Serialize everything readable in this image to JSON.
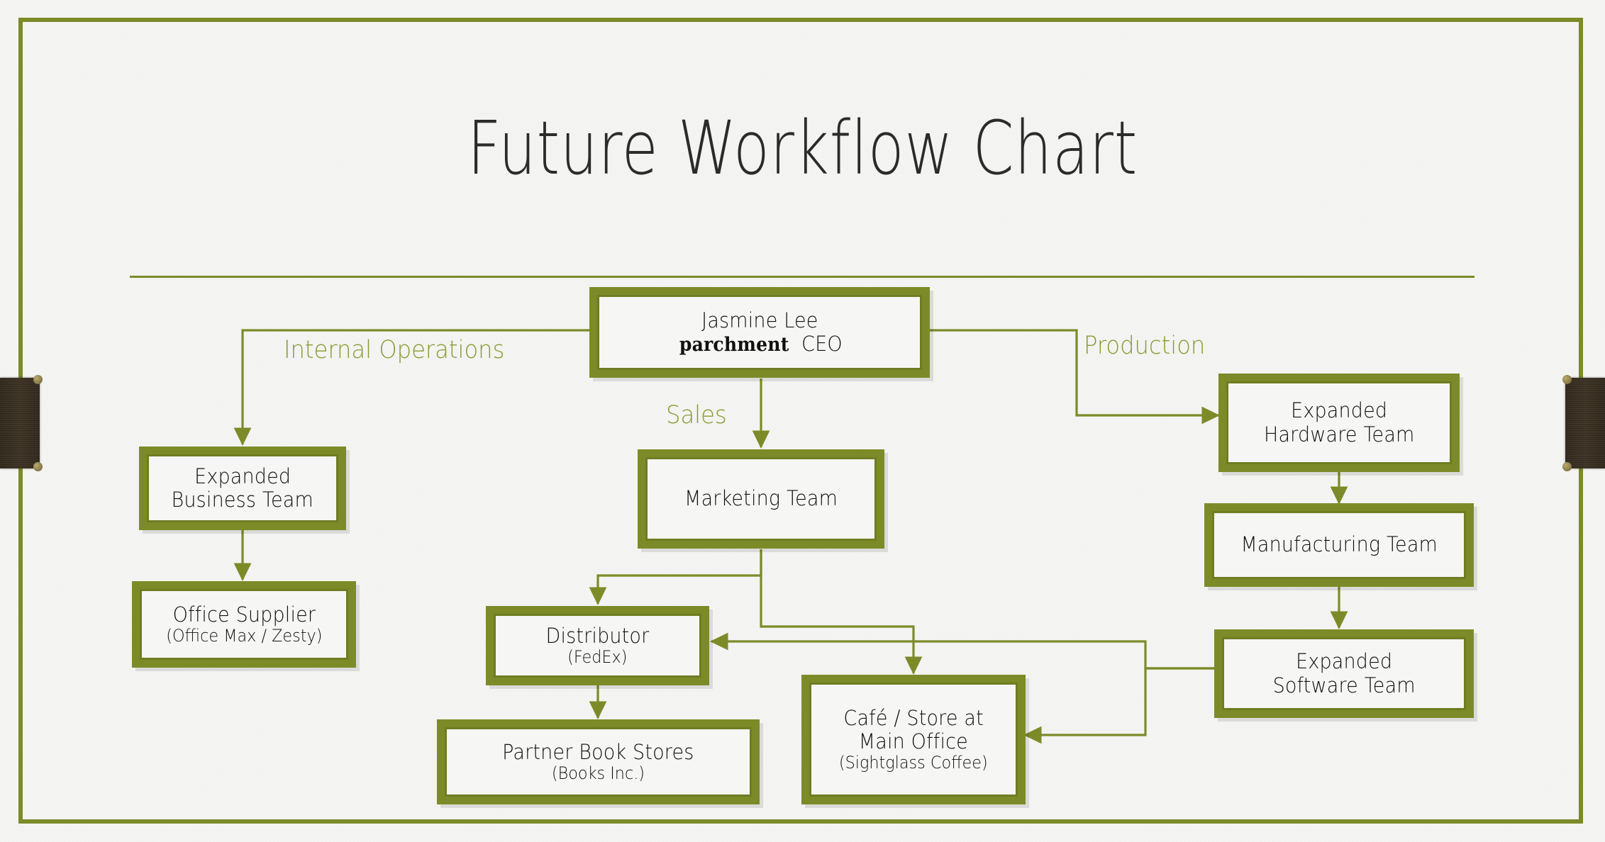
{
  "slide": {
    "title": "Future Workflow Chart",
    "accent_color": "#7c8b28",
    "label_color": "#8a9a33",
    "frame_color": "#7c8b28",
    "tab_color": "#3d3325",
    "background_color": "#f4f4f2"
  },
  "branch_labels": {
    "internal_operations": "Internal Operations",
    "sales": "Sales",
    "production": "Production"
  },
  "nodes": {
    "ceo": {
      "line1": "Jasmine Lee",
      "line2_brand": "parchment",
      "line2_role": "CEO"
    },
    "business_team": {
      "line1": "Expanded",
      "line2": "Business Team"
    },
    "office_supplier": {
      "line1": "Office Supplier",
      "line2": "(Office Max / Zesty)"
    },
    "marketing_team": {
      "line1": "Marketing Team"
    },
    "distributor": {
      "line1": "Distributor",
      "line2": "(FedEx)"
    },
    "partner_stores": {
      "line1": "Partner Book Stores",
      "line2": "(Books Inc.)"
    },
    "cafe_store": {
      "line1": "Café / Store at",
      "line2": "Main Office",
      "line3": "(Sightglass Coffee)"
    },
    "hardware_team": {
      "line1": "Expanded",
      "line2": "Hardware Team"
    },
    "manufacturing": {
      "line1": "Manufacturing Team"
    },
    "software_team": {
      "line1": "Expanded",
      "line2": "Software Team"
    }
  },
  "chart_data": {
    "type": "diagram",
    "title": "Future Workflow Chart",
    "nodes": [
      "Jasmine Lee / parchment CEO",
      "Expanded Business Team",
      "Office Supplier (Office Max / Zesty)",
      "Marketing Team",
      "Distributor (FedEx)",
      "Partner Book Stores (Books Inc.)",
      "Café / Store at Main Office (Sightglass Coffee)",
      "Expanded Hardware Team",
      "Manufacturing Team",
      "Expanded Software Team"
    ],
    "edges": [
      {
        "from": "Jasmine Lee / parchment CEO",
        "to": "Expanded Business Team",
        "label": "Internal Operations"
      },
      {
        "from": "Jasmine Lee / parchment CEO",
        "to": "Marketing Team",
        "label": "Sales"
      },
      {
        "from": "Jasmine Lee / parchment CEO",
        "to": "Expanded Hardware Team",
        "label": "Production"
      },
      {
        "from": "Expanded Business Team",
        "to": "Office Supplier (Office Max / Zesty)",
        "label": ""
      },
      {
        "from": "Marketing Team",
        "to": "Distributor (FedEx)",
        "label": ""
      },
      {
        "from": "Marketing Team",
        "to": "Café / Store at Main Office (Sightglass Coffee)",
        "label": ""
      },
      {
        "from": "Distributor (FedEx)",
        "to": "Partner Book Stores (Books Inc.)",
        "label": ""
      },
      {
        "from": "Expanded Hardware Team",
        "to": "Manufacturing Team",
        "label": ""
      },
      {
        "from": "Manufacturing Team",
        "to": "Expanded Software Team",
        "label": ""
      },
      {
        "from": "Expanded Software Team",
        "to": "Distributor (FedEx)",
        "label": ""
      },
      {
        "from": "Expanded Software Team",
        "to": "Café / Store at Main Office (Sightglass Coffee)",
        "label": ""
      }
    ]
  }
}
